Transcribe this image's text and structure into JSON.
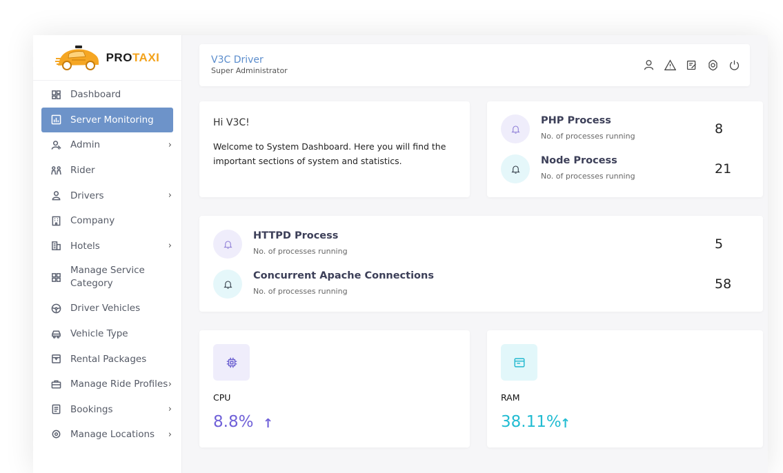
{
  "brand": {
    "pro": "PRO",
    "taxi": "TAXI"
  },
  "sidebar": {
    "items": [
      {
        "label": "Dashboard",
        "icon": "dashboard-icon",
        "chevron": false
      },
      {
        "label": "Server Monitoring",
        "icon": "chart-icon",
        "chevron": false,
        "active": true
      },
      {
        "label": "Admin",
        "icon": "admin-icon",
        "chevron": true
      },
      {
        "label": "Rider",
        "icon": "rider-icon",
        "chevron": false
      },
      {
        "label": "Drivers",
        "icon": "driver-icon",
        "chevron": true
      },
      {
        "label": "Company",
        "icon": "company-icon",
        "chevron": false
      },
      {
        "label": "Hotels",
        "icon": "hotel-icon",
        "chevron": true
      },
      {
        "label": "Manage Service Category",
        "icon": "category-icon",
        "chevron": false
      },
      {
        "label": "Driver Vehicles",
        "icon": "steering-icon",
        "chevron": false
      },
      {
        "label": "Vehicle Type",
        "icon": "car-icon",
        "chevron": false
      },
      {
        "label": "Rental Packages",
        "icon": "package-icon",
        "chevron": false
      },
      {
        "label": "Manage Ride Profiles",
        "icon": "briefcase-icon",
        "chevron": true
      },
      {
        "label": "Bookings",
        "icon": "bookings-icon",
        "chevron": true
      },
      {
        "label": "Manage Locations",
        "icon": "location-icon",
        "chevron": true
      }
    ],
    "chevron_glyph": "›"
  },
  "header": {
    "user_name": "V3C Driver",
    "user_role": "Super Administrator"
  },
  "welcome": {
    "greeting": "Hi V3C!",
    "message": "Welcome to System Dashboard. Here you will find the important sections of system and statistics."
  },
  "processes": {
    "php": {
      "title": "PHP Process",
      "subtitle": "No. of processes running",
      "value": "8"
    },
    "node": {
      "title": "Node Process",
      "subtitle": "No. of processes running",
      "value": "21"
    },
    "httpd": {
      "title": "HTTPD Process",
      "subtitle": "No. of processes running",
      "value": "5"
    },
    "apache": {
      "title": "Concurrent Apache Connections",
      "subtitle": "No. of processes running",
      "value": "58"
    }
  },
  "stats": {
    "cpu": {
      "label": "CPU",
      "value": "8.8%",
      "trend": "↑"
    },
    "ram": {
      "label": "RAM",
      "value": "38.11%",
      "trend": "↑"
    }
  },
  "colors": {
    "accent": "#6d93c9",
    "brand_orange": "#f3a21b",
    "cpu": "#7061d8",
    "ram": "#22bcd2",
    "user_name": "#5a8ccc"
  }
}
